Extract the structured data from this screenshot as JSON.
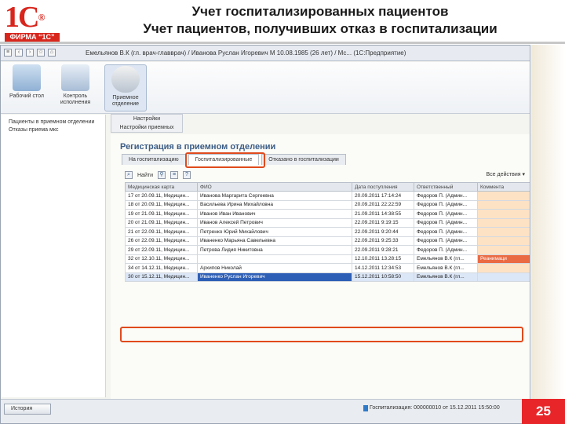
{
  "header": {
    "logo_mark": "1С",
    "logo_firm": "ФИРМА “1С”",
    "title_line1": "Учет госпитализированных пациентов",
    "title_line2": "Учет пациентов, получивших отказ в госпитализации"
  },
  "window": {
    "title": "Емельянов В.К (гл. врач-главврач) / Иванова Руслан Игоревич М 10.08.1985 (26 лет) / Мс... (1С:Предприятие)"
  },
  "sections": [
    {
      "label": "Рабочий стол",
      "icon": "desktop-icon"
    },
    {
      "label": "Контроль исполнения",
      "icon": "checklist-icon"
    },
    {
      "label": "Приемное отделение",
      "icon": "doctor-icon"
    }
  ],
  "nav": {
    "items": [
      "Пациенты в приемном отделении",
      "Отказы приема мкс"
    ]
  },
  "settings": {
    "title": "Настройки",
    "item": "Настройки приемных"
  },
  "form": {
    "title": "Регистрация в приемном отделении",
    "tabs": [
      "На госпитализацию",
      "Госпитализированные",
      "Отказано в госпитализации"
    ],
    "active_tab": 1
  },
  "toolbar": {
    "find_label": "Найти",
    "all_actions": "Все действия ▾"
  },
  "grid": {
    "columns": [
      "Медицинская карта",
      "ФИО",
      "Дата поступления",
      "Ответственный",
      "Коммента"
    ],
    "rows": [
      [
        "17 от 20.09.11, Медицин...",
        "Иванова Маргарита Сергеевна",
        "20.09.2011 17:14:24",
        "Федоров П. (Админ...",
        ""
      ],
      [
        "18 от 20.09.11, Медицин...",
        "Васильева Ирина Михайловна",
        "20.09.2011 22:22:59",
        "Федоров П. (Админ...",
        ""
      ],
      [
        "19 от 21.09.11, Медицин...",
        "Иванов Иван Иванович",
        "21.09.2011 14:38:55",
        "Федоров П. (Админ...",
        ""
      ],
      [
        "20 от 21.09.11, Медицин...",
        "Иванов Алексей Петрович",
        "22.09.2011 9:19:15",
        "Федоров П. (Админ...",
        ""
      ],
      [
        "21 от 22.09.11, Медицин...",
        "Петренко Юрий Михайлович",
        "22.09.2011 9:20:44",
        "Федоров П. (Админ...",
        ""
      ],
      [
        "26 от 22.09.11, Медицин...",
        "Иваненко Марьяна Савельевна",
        "22.09.2011 9:25:33",
        "Федоров П. (Админ...",
        ""
      ],
      [
        "29 от 22.09.11, Медицин...",
        "Петрова Лидия Никитовна",
        "22.09.2011 9:28:21",
        "Федоров П. (Админ...",
        ""
      ],
      [
        "32 от 12.10.11, Медицин...",
        "",
        "12.10.2011 13.28:15",
        "Емельянов В.К (гл...",
        "Реанимаци"
      ],
      [
        "34 от 14.12.11, Медицин...",
        "Архипов Николай",
        "14.12.2011 12:34:53",
        "Емельянов В.К (гл...",
        ""
      ],
      [
        "30 от 15.12.11, Медицин...",
        "Иваненко Руслан Игоревич",
        "15.12.2011 10:58:50",
        "Емельянов В.К (гл...",
        ""
      ]
    ]
  },
  "statusbar": {
    "history_label": "История",
    "status_text": "Госпитализация: 000000010 от 15.12.2011 15:50:00"
  },
  "slide_number": "25",
  "colors": {
    "brand_red": "#d8261d",
    "highlight_orange": "#e04a1c",
    "form_title_blue": "#3b5d86",
    "selection_blue": "#2e5fb6",
    "comment_orange": "#fde2c4",
    "comment_red": "#ea6a44"
  }
}
